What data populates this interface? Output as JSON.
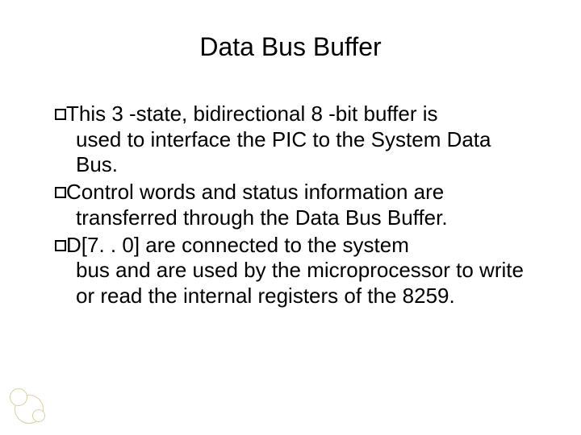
{
  "slide": {
    "title": "Data Bus Buffer",
    "bullets": [
      {
        "first": "This 3 -state, bidirectional 8 -bit buffer is",
        "cont": "used to interface the PIC to the System Data Bus."
      },
      {
        "first": "Control words and status information are",
        "cont": "transferred through the Data Bus Buffer."
      },
      {
        "first": "D[7. . 0]    are connected to the system",
        "cont": "bus and are used by the microprocessor to write or read the internal registers of the 8259."
      }
    ]
  }
}
